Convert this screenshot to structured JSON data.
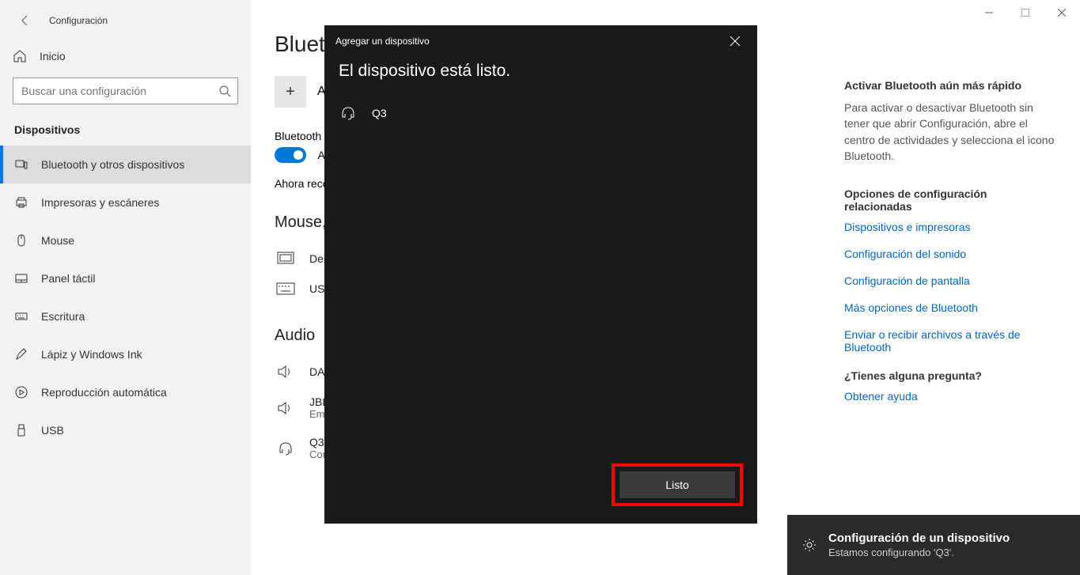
{
  "header": {
    "title": "Configuración"
  },
  "sidebar": {
    "home": "Inicio",
    "search_placeholder": "Buscar una configuración",
    "section": "Dispositivos",
    "items": [
      {
        "label": "Bluetooth y otros dispositivos"
      },
      {
        "label": "Impresoras y escáneres"
      },
      {
        "label": "Mouse"
      },
      {
        "label": "Panel táctil"
      },
      {
        "label": "Escritura"
      },
      {
        "label": "Lápiz y Windows Ink"
      },
      {
        "label": "Reproducción automática"
      },
      {
        "label": "USB"
      }
    ]
  },
  "main": {
    "heading": "Bluetooth y otros dispositivos",
    "add_label": "Agregar Bluetooth u otro dispositivo",
    "bt_label": "Bluetooth",
    "toggle_state": "Activado",
    "discover_text": "Ahora reconocible como",
    "group_mkt": "Mouse, teclado y lápiz",
    "mkt_items": [
      {
        "name": "Dell Touchpad"
      },
      {
        "name": "USB Keyboard"
      }
    ],
    "group_audio": "Audio",
    "audio_items": [
      {
        "name": "DA",
        "sub": ""
      },
      {
        "name": "JBL",
        "sub": "Emparejado"
      },
      {
        "name": "Q3",
        "sub": "Conectado"
      }
    ]
  },
  "right": {
    "h1": "Activar Bluetooth aún más rápido",
    "p1": "Para activar o desactivar Bluetooth sin tener que abrir Configuración, abre el centro de actividades y selecciona el icono Bluetooth.",
    "h2": "Opciones de configuración relacionadas",
    "links": [
      "Dispositivos e impresoras",
      "Configuración del sonido",
      "Configuración de pantalla",
      "Más opciones de Bluetooth",
      "Enviar o recibir archivos a través de Bluetooth"
    ],
    "h3": "¿Tienes alguna pregunta?",
    "help": "Obtener ayuda"
  },
  "dialog": {
    "title": "Agregar un dispositivo",
    "heading": "El dispositivo está listo.",
    "device": "Q3",
    "done": "Listo"
  },
  "toast": {
    "title": "Configuración de un dispositivo",
    "sub": "Estamos configurando 'Q3'."
  }
}
